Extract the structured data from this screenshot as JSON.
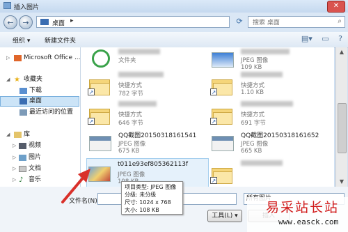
{
  "window": {
    "title": "插入图片",
    "close_glyph": "✕"
  },
  "address_bar": {
    "back_glyph": "←",
    "forward_glyph": "→",
    "location": "桌面",
    "separator": "▸",
    "refresh_glyph": "⟳"
  },
  "search": {
    "placeholder": "搜索 桌面",
    "icon": "search-icon"
  },
  "toolbar": {
    "organize": "组织 ▾",
    "new_folder": "新建文件夹",
    "icons": [
      "view-options-icon",
      "preview-pane-icon",
      "help-icon"
    ]
  },
  "nav": {
    "items": [
      {
        "label": "Microsoft Office ...",
        "icon": "office-icon"
      },
      {
        "label": "收藏夹",
        "icon": "favorites-star-icon"
      },
      {
        "label": "下载",
        "icon": "download-folder-icon"
      },
      {
        "label": "桌面",
        "icon": "desktop-icon",
        "selected": true
      },
      {
        "label": "最近访问的位置",
        "icon": "recent-places-icon"
      },
      {
        "label": "库",
        "icon": "library-icon"
      },
      {
        "label": "视频",
        "icon": "video-library-icon"
      },
      {
        "label": "图片",
        "icon": "pictures-library-icon"
      },
      {
        "label": "文档",
        "icon": "documents-library-icon"
      },
      {
        "label": "音乐",
        "icon": "music-library-icon"
      }
    ]
  },
  "files": [
    {
      "name": "",
      "type": "文件夹",
      "size": "",
      "icon": "app-shortcut-icon"
    },
    {
      "name": "",
      "type": "JPEG 图像",
      "size": "109 KB",
      "icon": "jpeg-thumbnail-icon"
    },
    {
      "name": "",
      "type": "快捷方式",
      "size": "782 字节",
      "icon": "folder-shortcut-icon"
    },
    {
      "name": "",
      "type": "快捷方式",
      "size": "1.10 KB",
      "icon": "folder-shortcut-icon"
    },
    {
      "name": "",
      "type": "快捷方式",
      "size": "646 字节",
      "icon": "folder-shortcut-icon"
    },
    {
      "name": "",
      "type": "快捷方式",
      "size": "691 字节",
      "icon": "folder-shortcut-icon"
    },
    {
      "name": "QQ截图20150318161541",
      "type": "JPEG 图像",
      "size": "675 KB",
      "icon": "jpeg-thumbnail-icon"
    },
    {
      "name": "QQ截图20150318161652",
      "type": "JPEG 图像",
      "size": "665 KB",
      "icon": "jpeg-thumbnail-icon"
    },
    {
      "name": "t011e93ef805362113f",
      "type": "JPEG 图像",
      "size": "108 KB",
      "icon": "jpeg-thumbnail-icon"
    },
    {
      "name": "",
      "type": "",
      "size": "",
      "icon": "folder-shortcut-icon"
    }
  ],
  "tooltip": {
    "line1": "项目类型: JPEG 图像",
    "line2": "分级: 未分级",
    "line3": "尺寸: 1024 x 768",
    "line4": "大小: 108 KB"
  },
  "bottom": {
    "filename_label": "文件名(N):",
    "filename_value": "",
    "filter": "所有图片",
    "tools": "工具(L) ▾",
    "insert": "插入"
  },
  "watermark": {
    "title": "易采站长站",
    "url": "www.easck.com"
  }
}
